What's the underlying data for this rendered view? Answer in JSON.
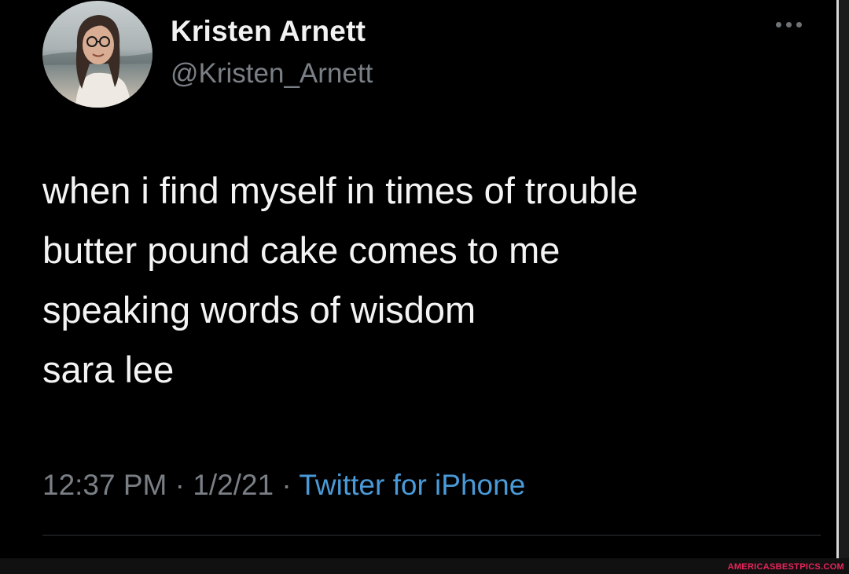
{
  "author": {
    "display_name": "Kristen Arnett",
    "handle": "@Kristen_Arnett",
    "avatar_icon": "profile-photo"
  },
  "more_icon": "ellipsis-icon",
  "tweet": {
    "lines": [
      "when i find myself in times of trouble",
      "butter pound cake comes to me",
      "speaking words of wisdom",
      "sara lee"
    ]
  },
  "meta": {
    "time": "12:37 PM",
    "separator": " · ",
    "date": "1/2/21",
    "source": "Twitter for iPhone"
  },
  "watermark": "AMERICASBESTPICS.COM",
  "colors": {
    "background": "#000000",
    "text": "#f4f4f4",
    "muted": "#7a7f85",
    "link": "#4a9ad8",
    "watermark": "#e8245b"
  }
}
